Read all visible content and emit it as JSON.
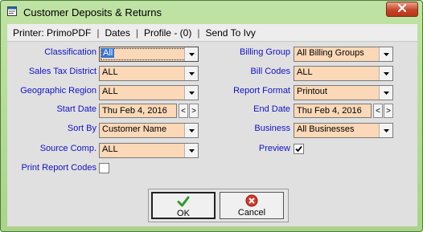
{
  "window": {
    "title": "Customer Deposits & Returns"
  },
  "menu": {
    "items": [
      "Printer: PrimoPDF",
      "Dates",
      "Profile - (0)",
      "Send To Ivy"
    ],
    "separator": "|"
  },
  "left": {
    "classification": {
      "label": "Classification",
      "value": "All"
    },
    "sales_tax_district": {
      "label": "Sales Tax District",
      "value": "ALL"
    },
    "geographic_region": {
      "label": "Geographic Region",
      "value": "ALL"
    },
    "start_date": {
      "label": "Start Date",
      "value": "Thu Feb 4, 2016"
    },
    "sort_by": {
      "label": "Sort By",
      "value": "Customer Name"
    },
    "source_comp": {
      "label": "Source Comp.",
      "value": "ALL"
    },
    "print_report_codes": {
      "label": "Print Report Codes",
      "checked": false
    }
  },
  "right": {
    "billing_group": {
      "label": "Billing Group",
      "value": "All Billing Groups"
    },
    "bill_codes": {
      "label": "Bill Codes",
      "value": "ALL"
    },
    "report_format": {
      "label": "Report Format",
      "value": "Printout"
    },
    "end_date": {
      "label": "End Date",
      "value": "Thu Feb 4, 2016"
    },
    "business": {
      "label": "Business",
      "value": "All Businesses"
    },
    "preview": {
      "label": "Preview",
      "checked": true
    }
  },
  "spin": {
    "prev": "<",
    "next": ">"
  },
  "buttons": {
    "ok": "OK",
    "cancel": "Cancel"
  },
  "icons": {
    "title": "form-icon",
    "close": "close-icon",
    "dropdown": "chevron-down-icon",
    "ok": "checkmark-icon",
    "cancel": "cancel-icon"
  },
  "colors": {
    "label": "#1111c8",
    "field_bg": "#fbd8b7",
    "titlebar": "#a9d48a",
    "close_button": "#c8452a"
  }
}
